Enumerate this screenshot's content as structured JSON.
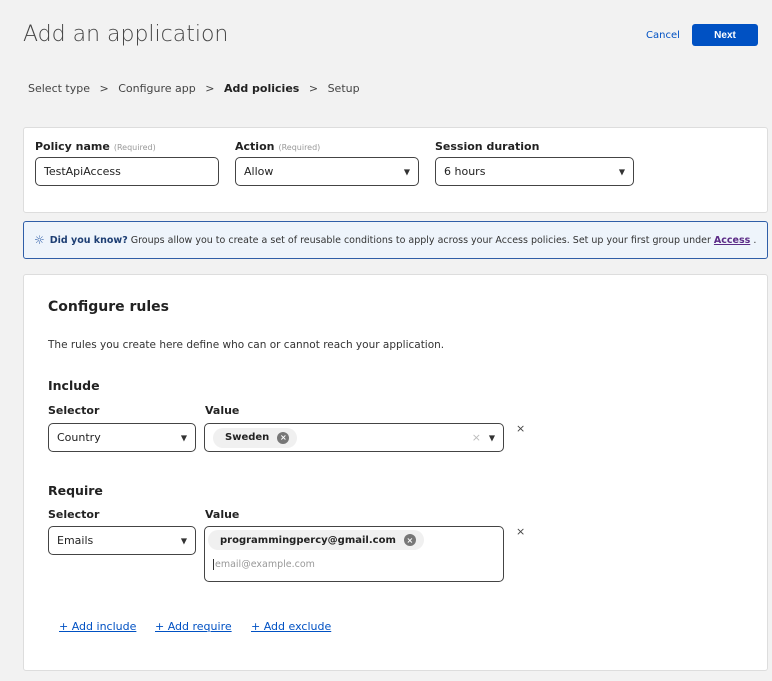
{
  "header": {
    "title": "Add an application",
    "cancel_label": "Cancel",
    "next_label": "Next"
  },
  "breadcrumb": [
    "Select type",
    " > ",
    "Configure app",
    " > ",
    "Add policies",
    " > ",
    "Setup"
  ],
  "policy": {
    "name_label": "Policy name",
    "name_req": "(Required)",
    "name_value": "TestApiAccess",
    "action_label": "Action",
    "action_req": "(Required)",
    "action_value": "Allow",
    "session_label": "Session duration",
    "session_value": "6 hours"
  },
  "banner": {
    "bold": "Did you know?",
    "text": "Groups allow you to create a set of reusable conditions to apply across your Access policies. Set up your first group under",
    "link": "Access",
    "end": "."
  },
  "rules": {
    "title": "Configure rules",
    "description": "The rules you create here define who can or cannot reach your application.",
    "include": {
      "heading": "Include",
      "selector_label": "Selector",
      "value_label": "Value",
      "selector_value": "Country",
      "chips": [
        "Sweden"
      ]
    },
    "require": {
      "heading": "Require",
      "selector_label": "Selector",
      "value_label": "Value",
      "selector_value": "Emails",
      "chips": [
        "programmingpercy@gmail.com"
      ],
      "placeholder": "email@example.com"
    },
    "links": {
      "add_include": "+ Add include",
      "add_require": "+ Add require",
      "add_exclude": "+ Add exclude"
    }
  }
}
